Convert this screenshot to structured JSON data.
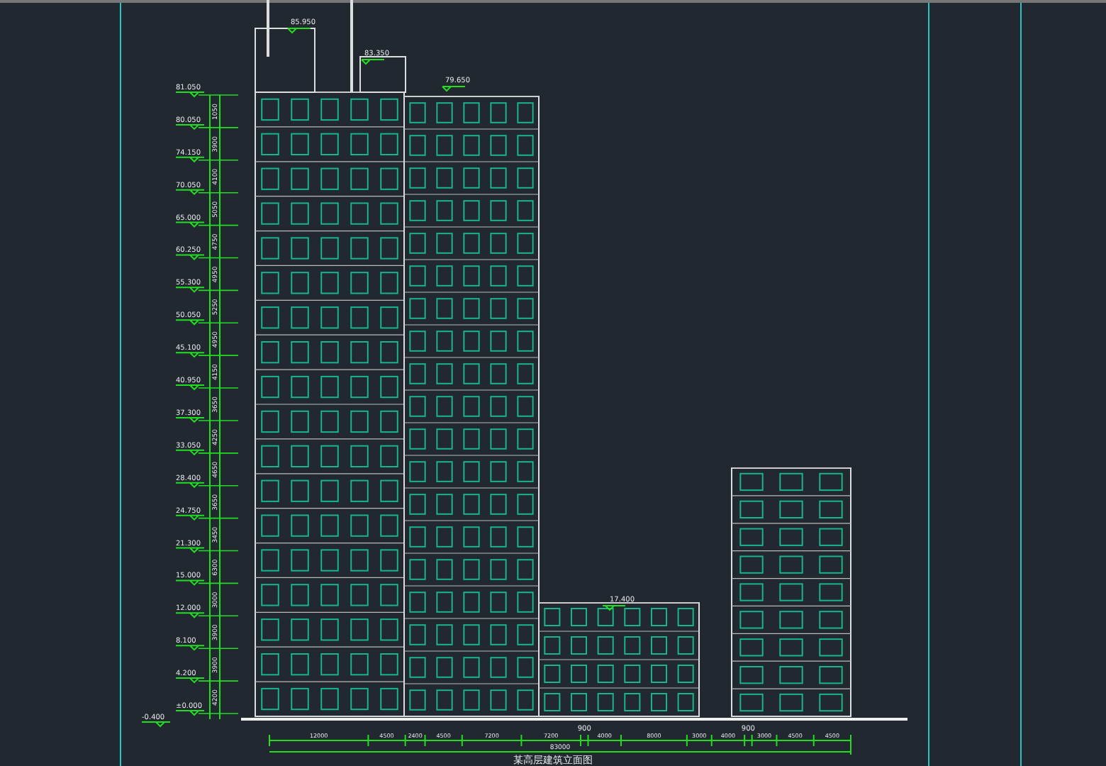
{
  "drawing": {
    "title": "某高层建筑立面图",
    "elevation_marks": [
      {
        "label": "81.050"
      },
      {
        "label": "80.050"
      },
      {
        "label": "74.150"
      },
      {
        "label": "70.050"
      },
      {
        "label": "65.000"
      },
      {
        "label": "60.250"
      },
      {
        "label": "55.300"
      },
      {
        "label": "50.050"
      },
      {
        "label": "45.100"
      },
      {
        "label": "40.950"
      },
      {
        "label": "37.300"
      },
      {
        "label": "33.050"
      },
      {
        "label": "28.400"
      },
      {
        "label": "24.750"
      },
      {
        "label": "21.300"
      },
      {
        "label": "15.000"
      },
      {
        "label": "12.000"
      },
      {
        "label": "8.100"
      },
      {
        "label": "4.200"
      },
      {
        "label": "±0.000"
      }
    ],
    "floor_heights": [
      "1050",
      "3900",
      "4100",
      "5050",
      "4750",
      "4950",
      "5250",
      "4950",
      "4150",
      "3650",
      "4250",
      "4650",
      "3650",
      "3450",
      "6300",
      "3000",
      "3900",
      "3900",
      "4200"
    ],
    "ground_mark": "-0.400",
    "roof_marks": [
      "85.950",
      "83.350",
      "79.650"
    ],
    "podium_mark": "17.400",
    "bottom_dimensions": [
      "12000",
      "4500",
      "2400",
      "4500",
      "7200",
      "7200",
      "900",
      "4000",
      "8000",
      "3000",
      "4000",
      "900",
      "3000",
      "4500",
      "4500"
    ],
    "total_dimension": "83000"
  }
}
